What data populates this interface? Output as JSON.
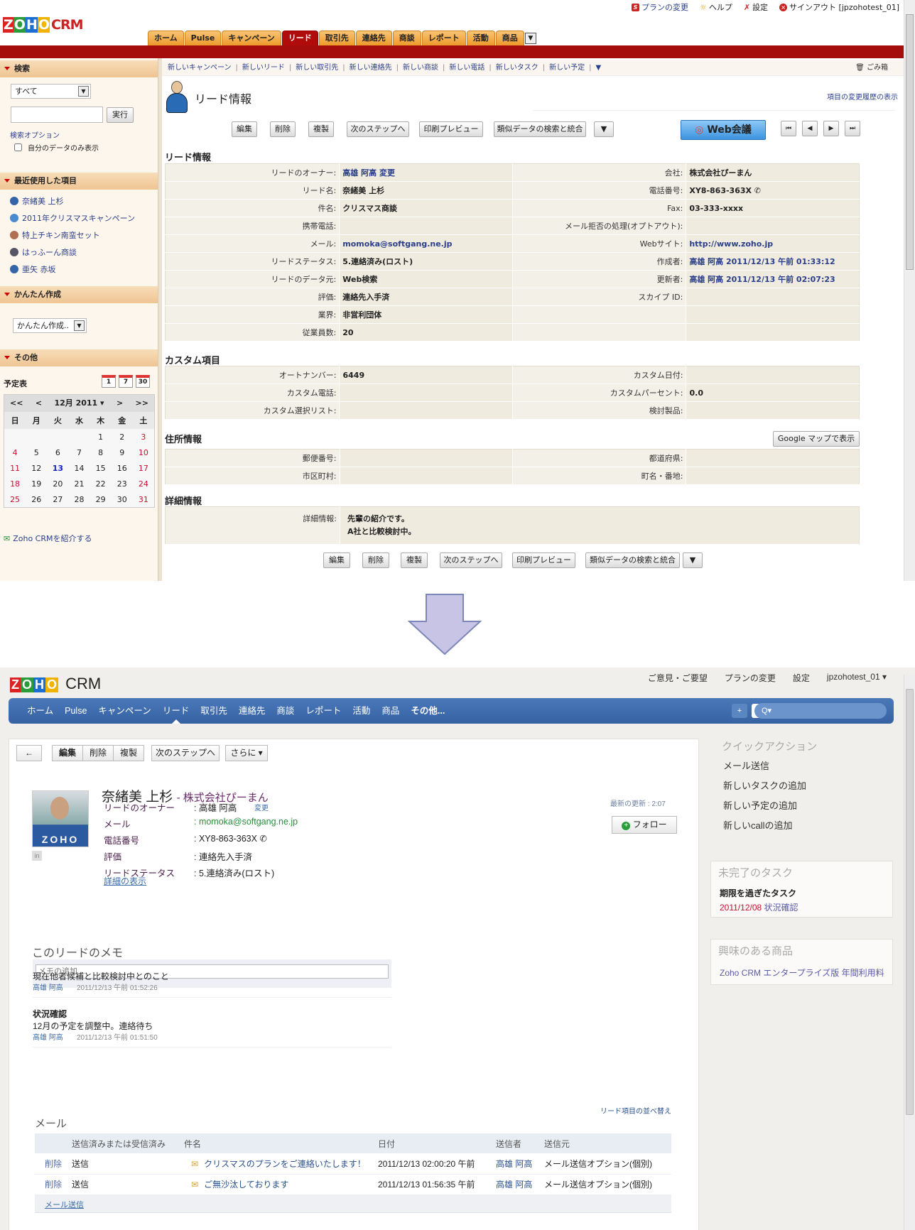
{
  "old": {
    "toplinks": [
      {
        "label": "プランの変更",
        "icon": "plan-icon"
      },
      {
        "label": "ヘルプ",
        "icon": "help-icon"
      },
      {
        "label": "設定",
        "icon": "settings-icon"
      },
      {
        "label": "サインアウト [jpzohotest_01]",
        "icon": "signout-icon"
      }
    ],
    "logo": {
      "z": "Z",
      "o1": "O",
      "h": "H",
      "o2": "O",
      "crm": "CRM"
    },
    "tabs": [
      "ホーム",
      "Pulse",
      "キャンペーン",
      "リード",
      "取引先",
      "連絡先",
      "商談",
      "レポート",
      "活動",
      "商品"
    ],
    "active_tab": "リード",
    "subnav": [
      "新しいキャンペーン",
      "新しいリード",
      "新しい取引先",
      "新しい連絡先",
      "新しい商談",
      "新しい電話",
      "新しいタスク",
      "新しい予定"
    ],
    "trash": "ごみ箱",
    "sidebar": {
      "search_header": "検索",
      "search_scope": "すべて",
      "search_value": "",
      "search_button": "実行",
      "search_options": "検索オプション",
      "my_data_only": "自分のデータのみ表示",
      "recent_header": "最近使用した項目",
      "recent": [
        "奈緒美 上杉",
        "2011年クリスマスキャンペーン",
        "特上チキン南蛮セット",
        "はっふーん商談",
        "亜矢 赤坂"
      ],
      "quick_header": "かんたん作成",
      "quick_select": "かんたん作成..",
      "other_header": "その他",
      "calendar_title": "予定表",
      "cal_icons": [
        "1",
        "7",
        "30"
      ],
      "cal_nav": {
        "first": "<<",
        "prev": "<",
        "month": "12月 2011 ▾",
        "next": ">",
        "last": ">>"
      },
      "weekdays": [
        "日",
        "月",
        "火",
        "水",
        "木",
        "金",
        "土"
      ],
      "weeks": [
        [
          "",
          "",
          "",
          "",
          "1",
          "2",
          "3"
        ],
        [
          "4",
          "5",
          "6",
          "7",
          "8",
          "9",
          "10"
        ],
        [
          "11",
          "12",
          "13",
          "14",
          "15",
          "16",
          "17"
        ],
        [
          "18",
          "19",
          "20",
          "21",
          "22",
          "23",
          "24"
        ],
        [
          "25",
          "26",
          "27",
          "28",
          "29",
          "30",
          "31"
        ]
      ],
      "today": "13",
      "refer": "Zoho CRMを紹介する"
    },
    "page_title": "リード情報",
    "history_link": "項目の変更履歴の表示",
    "buttons": [
      "編集",
      "削除",
      "複製",
      "次のステップへ",
      "印刷プレビュー",
      "類似データの検索と統合",
      "▼"
    ],
    "web_meeting": "Web会議",
    "record_nav": [
      "⏮",
      "◀",
      "▶",
      "⏭"
    ],
    "sections": {
      "lead_info": "リード情報",
      "custom": "カスタム項目",
      "address": "住所情報",
      "detail": "詳細情報"
    },
    "lead_rows": [
      [
        {
          "l": "リードのオーナー:",
          "v": "高雄 阿高 変更",
          "link": true
        },
        {
          "l": "会社:",
          "v": "株式会社ぴーまん"
        }
      ],
      [
        {
          "l": "リード名:",
          "v": "奈緒美 上杉"
        },
        {
          "l": "電話番号:",
          "v": "XY8-863-363X ✆"
        }
      ],
      [
        {
          "l": "件名:",
          "v": "クリスマス商談"
        },
        {
          "l": "Fax:",
          "v": "03-333-xxxx"
        }
      ],
      [
        {
          "l": "携帯電話:",
          "v": ""
        },
        {
          "l": "メール拒否の処理(オプトアウト):",
          "v": ""
        }
      ],
      [
        {
          "l": "メール:",
          "v": "momoka@softgang.ne.jp",
          "link": true
        },
        {
          "l": "Webサイト:",
          "v": "http://www.zoho.jp",
          "link": true
        }
      ],
      [
        {
          "l": "リードステータス:",
          "v": "5.連絡済み(ロスト)"
        },
        {
          "l": "作成者:",
          "v": "高雄 阿高 2011/12/13 午前 01:33:12",
          "link": true
        }
      ],
      [
        {
          "l": "リードのデータ元:",
          "v": "Web検索"
        },
        {
          "l": "更新者:",
          "v": "高雄 阿高 2011/12/13 午前 02:07:23",
          "link": true
        }
      ],
      [
        {
          "l": "評価:",
          "v": "連絡先入手済"
        },
        {
          "l": "スカイプ ID:",
          "v": ""
        }
      ],
      [
        {
          "l": "業界:",
          "v": "非営利団体"
        },
        {
          "l": "",
          "v": ""
        }
      ],
      [
        {
          "l": "従業員数:",
          "v": "20"
        },
        {
          "l": "",
          "v": ""
        }
      ]
    ],
    "custom_rows": [
      [
        {
          "l": "オートナンバー:",
          "v": "6449"
        },
        {
          "l": "カスタム日付:",
          "v": ""
        }
      ],
      [
        {
          "l": "カスタム電話:",
          "v": ""
        },
        {
          "l": "カスタムパーセント:",
          "v": "0.0"
        }
      ],
      [
        {
          "l": "カスタム選択リスト:",
          "v": ""
        },
        {
          "l": "検討製品:",
          "v": ""
        }
      ]
    ],
    "google_map": "Google マップで表示",
    "address_rows": [
      [
        {
          "l": "郵便番号:",
          "v": ""
        },
        {
          "l": "都道府県:",
          "v": ""
        }
      ],
      [
        {
          "l": "市区町村:",
          "v": ""
        },
        {
          "l": "町名・番地:",
          "v": ""
        }
      ]
    ],
    "detail_label": "詳細情報:",
    "detail_lines": [
      "先輩の紹介です。",
      "A社と比較検討中。"
    ]
  },
  "new": {
    "toplinks": [
      "ご意見・ご要望",
      "プランの変更",
      "設定",
      "jpzohotest_01 ▾"
    ],
    "logo": {
      "z": "Z",
      "o1": "O",
      "h": "H",
      "o2": "O",
      "crm": "CRM"
    },
    "nav": [
      "ホーム",
      "Pulse",
      "キャンペーン",
      "リード",
      "取引先",
      "連絡先",
      "商談",
      "レポート",
      "活動",
      "商品",
      "その他..."
    ],
    "active_nav": "リード",
    "search_placeholder": "Q▾",
    "toolbar": {
      "back": "←",
      "edit": "編集",
      "delete": "削除",
      "clone": "複製",
      "next": "次のステップへ",
      "more": "さらに ▾"
    },
    "lead_name": "奈緒美 上杉",
    "company": "- 株式会社ぴーまん",
    "fields": [
      {
        "label": "リードのオーナー",
        "value": ": 高雄 阿高",
        "extra": "変更"
      },
      {
        "label": "メール",
        "value": ": momoka@softgang.ne.jp"
      },
      {
        "label": "電話番号",
        "value": ": XY8-863-363X ✆"
      },
      {
        "label": "評価",
        "value": ": 連絡先入手済"
      },
      {
        "label": "リードステータス",
        "value": ": 5.連絡済み(ロスト)"
      }
    ],
    "photo_logo": "ZOHO",
    "linkedin": "in",
    "show_details": "詳細の表示",
    "last_updated": "最新の更新 : 2:07",
    "follow": "フォロー",
    "notes_title": "このリードのメモ",
    "notes_placeholder": "メモの追加 ...",
    "notes": [
      {
        "title": "",
        "body": "現在他者候補と比較検討中とのこと",
        "author": "高雄 阿高",
        "time": "2011/12/13 午前 01:52:26"
      },
      {
        "title": "状況確認",
        "body": "12月の予定を調整中。連絡待ち",
        "author": "高雄 阿高",
        "time": "2011/12/13 午前 01:51:50"
      }
    ],
    "sort_link": "リード項目の並べ替え",
    "mail_title": "メール",
    "mail_headers": [
      "",
      "送信済みまたは受信済み",
      "件名",
      "日付",
      "送信者",
      "送信元"
    ],
    "mails": [
      {
        "action": "削除",
        "type": "送信",
        "subject": "クリスマスのプランをご連絡いたします！",
        "date": "2011/12/13 02:00:20 午前",
        "sender": "高雄 阿高",
        "source": "メール送信オプション(個別)"
      },
      {
        "action": "削除",
        "type": "送信",
        "subject": "ご無沙汰しております",
        "date": "2011/12/13 01:56:35 午前",
        "sender": "高雄 阿高",
        "source": "メール送信オプション(個別)"
      }
    ],
    "send_mail": "メール送信",
    "quick_title": "クイックアクション",
    "quick_actions": [
      "メール送信",
      "新しいタスクの追加",
      "新しい予定の追加",
      "新しいcallの追加"
    ],
    "tasks_title": "未完了のタスク",
    "overdue_label": "期限を過ぎたタスク",
    "task_date": "2011/12/08",
    "task_name": "状況確認",
    "products_title": "興味のある商品",
    "product": "Zoho CRM エンタープライズ版 年間利用料"
  }
}
